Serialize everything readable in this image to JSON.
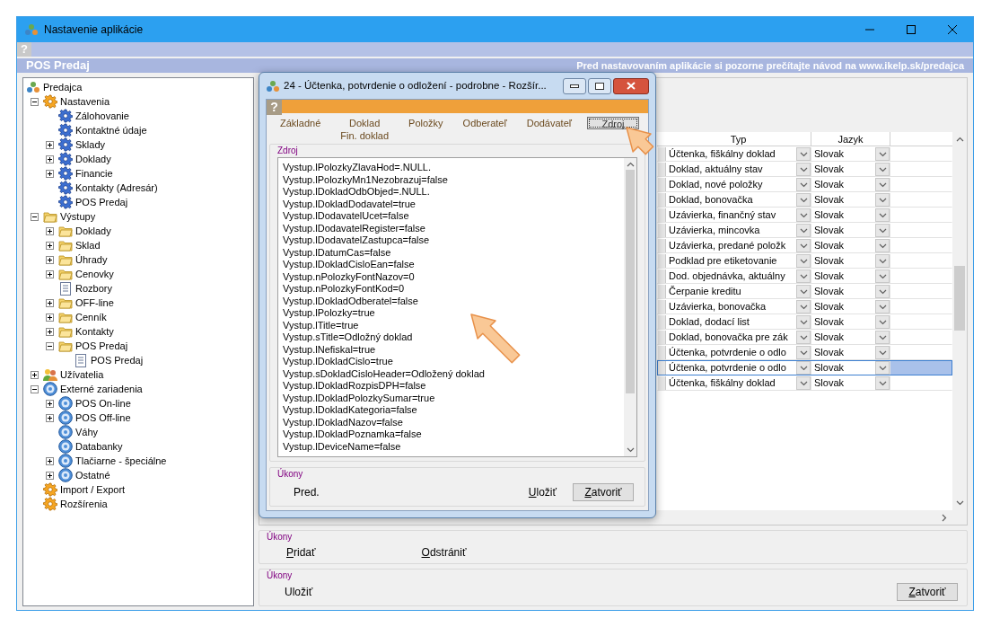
{
  "window": {
    "title": "Nastavenie aplikácie",
    "help": "?"
  },
  "header": {
    "title": "POS Predaj",
    "note": "Pred nastavovaním aplikácie si pozorne prečítajte návod na www.ikelp.sk/predajca"
  },
  "tree": [
    {
      "label": "Predajca",
      "kind": "app",
      "children": [
        {
          "label": "Nastavenia",
          "kind": "settings",
          "expanded": true,
          "children": [
            {
              "label": "Zálohovanie",
              "kind": "gear"
            },
            {
              "label": "Kontaktné údaje",
              "kind": "gear"
            },
            {
              "label": "Sklady",
              "kind": "gear",
              "expanded": false
            },
            {
              "label": "Doklady",
              "kind": "gear",
              "expanded": false
            },
            {
              "label": "Financie",
              "kind": "gear",
              "expanded": false
            },
            {
              "label": "Kontakty (Adresár)",
              "kind": "gear"
            },
            {
              "label": "POS Predaj",
              "kind": "gear"
            }
          ]
        },
        {
          "label": "Výstupy",
          "kind": "folder",
          "expanded": true,
          "children": [
            {
              "label": "Doklady",
              "kind": "folder",
              "expanded": false
            },
            {
              "label": "Sklad",
              "kind": "folder",
              "expanded": false
            },
            {
              "label": "Úhrady",
              "kind": "folder",
              "expanded": false
            },
            {
              "label": "Cenovky",
              "kind": "folder",
              "expanded": false
            },
            {
              "label": "Rozbory",
              "kind": "doc"
            },
            {
              "label": "OFF-line",
              "kind": "folder",
              "expanded": false
            },
            {
              "label": "Cenník",
              "kind": "folder",
              "expanded": false
            },
            {
              "label": "Kontakty",
              "kind": "folder",
              "expanded": false
            },
            {
              "label": "POS Predaj",
              "kind": "folder",
              "expanded": true,
              "children": [
                {
                  "label": "POS Predaj",
                  "kind": "doc"
                }
              ]
            }
          ]
        },
        {
          "label": "Užívatelia",
          "kind": "users",
          "expanded": false
        },
        {
          "label": "Externé zariadenia",
          "kind": "device",
          "expanded": true,
          "children": [
            {
              "label": "POS On-line",
              "kind": "device",
              "expanded": false
            },
            {
              "label": "POS Off-line",
              "kind": "device",
              "expanded": false
            },
            {
              "label": "Váhy",
              "kind": "device"
            },
            {
              "label": "Databanky",
              "kind": "device"
            },
            {
              "label": "Tlačiarne - špeciálne",
              "kind": "device",
              "expanded": false
            },
            {
              "label": "Ostatné",
              "kind": "device",
              "expanded": false
            }
          ]
        },
        {
          "label": "Import / Export",
          "kind": "settings"
        },
        {
          "label": "Rozšírenia",
          "kind": "settings"
        }
      ]
    }
  ],
  "grid": {
    "columns": [
      "Typ",
      "Jazyk"
    ],
    "rows": [
      {
        "type": "Účtenka, fiškálny doklad",
        "language": "Slovak",
        "selected": false
      },
      {
        "type": "Doklad, aktuálny stav",
        "language": "Slovak",
        "selected": false
      },
      {
        "type": "Doklad, nové položky",
        "language": "Slovak",
        "selected": false
      },
      {
        "type": "Doklad, bonovačka",
        "language": "Slovak",
        "selected": false
      },
      {
        "type": "Uzávierka, finančný stav",
        "language": "Slovak",
        "selected": false
      },
      {
        "type": "Uzávierka, mincovka",
        "language": "Slovak",
        "selected": false
      },
      {
        "type": "Uzávierka, predané položk",
        "language": "Slovak",
        "selected": false
      },
      {
        "type": "Podklad pre etiketovanie",
        "language": "Slovak",
        "selected": false
      },
      {
        "type": "Dod. objednávka, aktuálny",
        "language": "Slovak",
        "selected": false
      },
      {
        "type": "Čerpanie kreditu",
        "language": "Slovak",
        "selected": false
      },
      {
        "type": "Uzávierka, bonovačka",
        "language": "Slovak",
        "selected": false
      },
      {
        "type": "Doklad, dodací list",
        "language": "Slovak",
        "selected": false
      },
      {
        "type": "Doklad, bonovačka pre zák",
        "language": "Slovak",
        "selected": false
      },
      {
        "type": "Účtenka, potvrdenie o odlo",
        "language": "Slovak",
        "selected": false
      },
      {
        "type": "Účtenka, potvrdenie o odlo",
        "language": "Slovak",
        "selected": true
      },
      {
        "type": "Účtenka, fiškálny doklad",
        "language": "Slovak",
        "selected": false
      }
    ]
  },
  "actions": {
    "label": "Úkony",
    "buttons": [
      {
        "label": "Pridať",
        "kind": "flat",
        "accelerator": true
      },
      {
        "label": "Odstrániť",
        "kind": "flat",
        "accelerator": true
      }
    ]
  },
  "footer": {
    "label": "Úkony",
    "buttons": [
      {
        "label": "Uložiť",
        "kind": "flat",
        "accelerator": false
      },
      {
        "label": "Zatvoriť",
        "kind": "button",
        "accelerator": true
      }
    ]
  },
  "dialog": {
    "title": "24 - Účtenka, potvrdenie o odložení - podrobne - Rozšír...",
    "help": "?",
    "tabs": [
      {
        "label": "Základné",
        "selected": false
      },
      {
        "label": "Doklad\nFin. doklad",
        "selected": false
      },
      {
        "label": "Položky",
        "selected": false
      },
      {
        "label": "Odberateľ",
        "selected": false
      },
      {
        "label": "Dodávateľ",
        "selected": false
      },
      {
        "label": "Zdroj",
        "selected": true
      }
    ],
    "source": {
      "label": "Zdroj",
      "lines": [
        "Vystup.lPolozkyZlavaHod=.NULL.",
        "Vystup.lPolozkyMn1Nezobrazuj=false",
        "Vystup.lDokladOdbObjed=.NULL.",
        "Vystup.lDokladDodavatel=true",
        "Vystup.lDodavatelUcet=false",
        "Vystup.lDodavatelRegister=false",
        "Vystup.lDodavatelZastupca=false",
        "Vystup.lDatumCas=false",
        "Vystup.lDokladCisloEan=false",
        "Vystup.nPolozkyFontNazov=0",
        "Vystup.nPolozkyFontKod=0",
        "Vystup.lDokladOdberatel=false",
        "Vystup.lPolozky=true",
        "Vystup.lTitle=true",
        "Vystup.sTitle=Odložný doklad",
        "Vystup.lNefiskal=true",
        "Vystup.lDokladCislo=true",
        "Vystup.sDokladCisloHeader=Odložený doklad",
        "Vystup.lDokladRozpisDPH=false",
        "Vystup.lDokladPolozkySumar=true",
        "Vystup.lDokladKategoria=false",
        "Vystup.lDokladNazov=false",
        "Vystup.lDokladPoznamka=false",
        "Vystup.lDeviceName=false"
      ]
    },
    "actions": {
      "label": "Úkony",
      "buttons": [
        {
          "label": "Pred.",
          "kind": "flat",
          "accelerator": false
        },
        {
          "label": "Uložiť",
          "kind": "flat",
          "accelerator": true
        },
        {
          "label": "Zatvoriť",
          "kind": "button",
          "accelerator": true
        }
      ]
    }
  }
}
